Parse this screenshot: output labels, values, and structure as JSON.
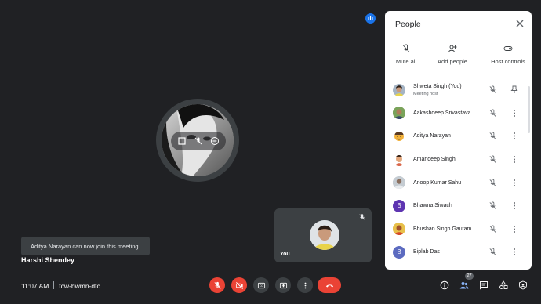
{
  "main": {
    "speaker_name": "Harshi Shendey",
    "toast": "Aditya Narayan can now join this meeting",
    "self_label": "You"
  },
  "panel": {
    "title": "People",
    "actions": [
      {
        "label": "Mute all",
        "icon": "mic-off-icon"
      },
      {
        "label": "Add people",
        "icon": "add-person-icon"
      },
      {
        "label": "Host controls",
        "icon": "toggle-icon"
      }
    ],
    "participants": [
      {
        "name": "Shweta Singh (You)",
        "sub": "Meeting host",
        "avatar_color": "#a5b4c4",
        "pinned": true
      },
      {
        "name": "Aakashdeep Srivastava",
        "sub": "",
        "avatar_color": "#6b8e4e"
      },
      {
        "name": "Aditya Narayan",
        "sub": "",
        "avatar_color": "#f2b13a"
      },
      {
        "name": "Amandeep Singh",
        "sub": "",
        "avatar_color": "#d9664a"
      },
      {
        "name": "Anoop Kumar Sahu",
        "sub": "",
        "avatar_color": "#b0b8c0"
      },
      {
        "name": "Bhawna Siwach",
        "sub": "",
        "avatar_color": "#5e35b1",
        "initial": "B"
      },
      {
        "name": "Bhushan Singh Gautam",
        "sub": "",
        "avatar_color": "#c9a227"
      },
      {
        "name": "Biplab Das",
        "sub": "",
        "avatar_color": "#5c6bc0",
        "initial": "B"
      }
    ]
  },
  "bottom": {
    "time": "11:07 AM",
    "meeting_code": "tcw-bwmn-dtc",
    "participant_count": "27"
  },
  "colors": {
    "background": "#202124",
    "danger": "#ea4335",
    "accent": "#1a73e8"
  }
}
